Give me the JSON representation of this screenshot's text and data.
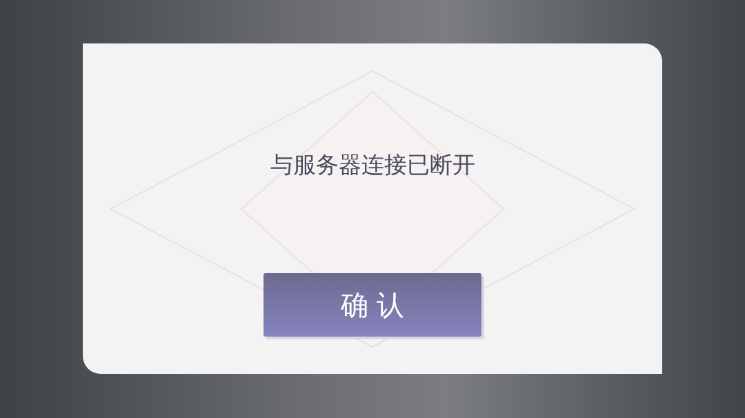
{
  "dialog": {
    "message": "与服务器连接已断开",
    "buttons": [
      {
        "label": "确 认"
      }
    ]
  }
}
